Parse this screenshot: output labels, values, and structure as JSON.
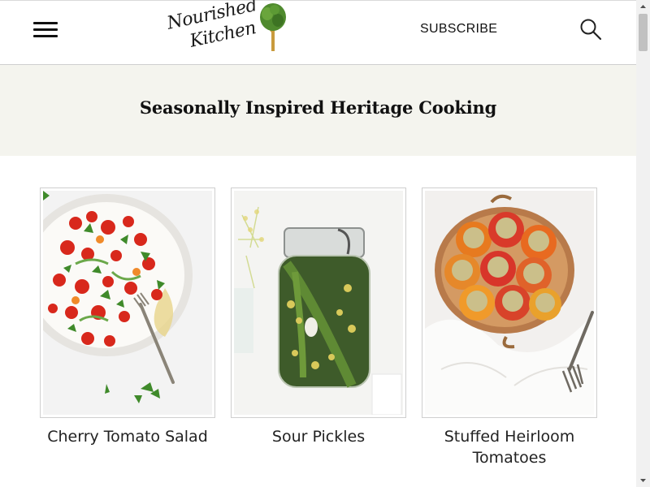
{
  "header": {
    "logo": {
      "line1": "Nourished",
      "line2": "Kitchen",
      "icon": "tree-icon"
    },
    "subscribe_label": "SUBSCRIBE",
    "menu_icon": "hamburger-menu-icon",
    "search_icon": "search-icon"
  },
  "tagline": "Seasonally Inspired Heritage Cooking",
  "recipes": [
    {
      "title": "Cherry Tomato Salad",
      "image": "cherry-tomato-salad-photo"
    },
    {
      "title": "Sour Pickles",
      "image": "sour-pickles-photo"
    },
    {
      "title": "Stuffed Heirloom Tomatoes",
      "image": "stuffed-heirloom-tomatoes-photo"
    }
  ],
  "colors": {
    "band_background": "#f4f4ee",
    "text": "#111111",
    "border": "#cfcfcf",
    "tree_green": "#4f8a2e",
    "tree_trunk": "#c99b3d"
  }
}
